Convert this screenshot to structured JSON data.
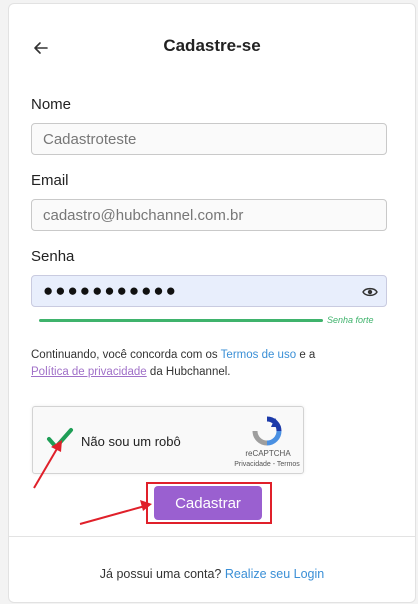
{
  "header": {
    "title": "Cadastre-se",
    "back_icon": "arrow-left-icon"
  },
  "form": {
    "name_label": "Nome",
    "name_value": "Cadastroteste",
    "email_label": "Email",
    "email_value": "cadastro@hubchannel.com.br",
    "password_label": "Senha",
    "password_value": "●●●●●●●●●●●",
    "password_toggle_icon": "eye-icon",
    "strength_label": "Senha forte",
    "strength_color": "#3fb36c"
  },
  "terms": {
    "prefix": "Continuando, você concorda com os",
    "terms_link": "Termos de uso",
    "middle": "e a",
    "privacy_link": "Política de privacidade",
    "suffix": "da Hubchannel."
  },
  "captcha": {
    "label": "Não sou um robô",
    "brand": "reCAPTCHA",
    "links": "Privacidade - Termos",
    "checked": true
  },
  "submit_label": "Cadastrar",
  "accent_color": "#9a60d0",
  "annotation_color": "#e0202a",
  "footer": {
    "prompt": "Já possui uma conta?",
    "login_link": "Realize seu Login"
  }
}
